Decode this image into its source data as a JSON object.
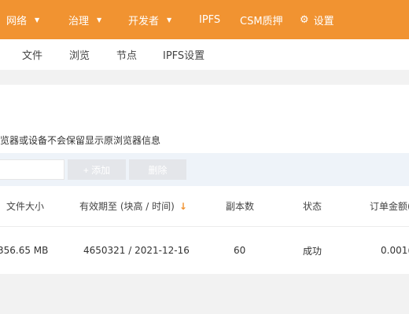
{
  "topnav": {
    "items": [
      {
        "label": "网络",
        "has_dropdown": true
      },
      {
        "label": "治理",
        "has_dropdown": true
      },
      {
        "label": "开发者",
        "has_dropdown": true
      },
      {
        "label": "IPFS",
        "has_dropdown": false
      },
      {
        "label": "CSM质押",
        "has_dropdown": false
      },
      {
        "label": "设置",
        "icon": "gear-icon"
      }
    ],
    "caret": "▼",
    "background": "#f19331"
  },
  "subnav": {
    "tabs": [
      "文件",
      "浏览",
      "节点",
      "IPFS设置"
    ]
  },
  "notice": {
    "text": "览器或设备不会保留显示原浏览器信息"
  },
  "toolbar": {
    "search_value": "",
    "add_label": "+ 添加",
    "delete_label": "删除"
  },
  "table": {
    "columns": [
      "文件大小",
      "有效期至 (块高 / 时间)",
      "副本数",
      "状态",
      "订单金额("
    ],
    "sort_icon": "↓",
    "rows": [
      {
        "size": "356.65 MB",
        "expiry": "4650321 / 2021-12-16",
        "replicas": "60",
        "status": "成功",
        "amount": "0.001("
      }
    ]
  }
}
